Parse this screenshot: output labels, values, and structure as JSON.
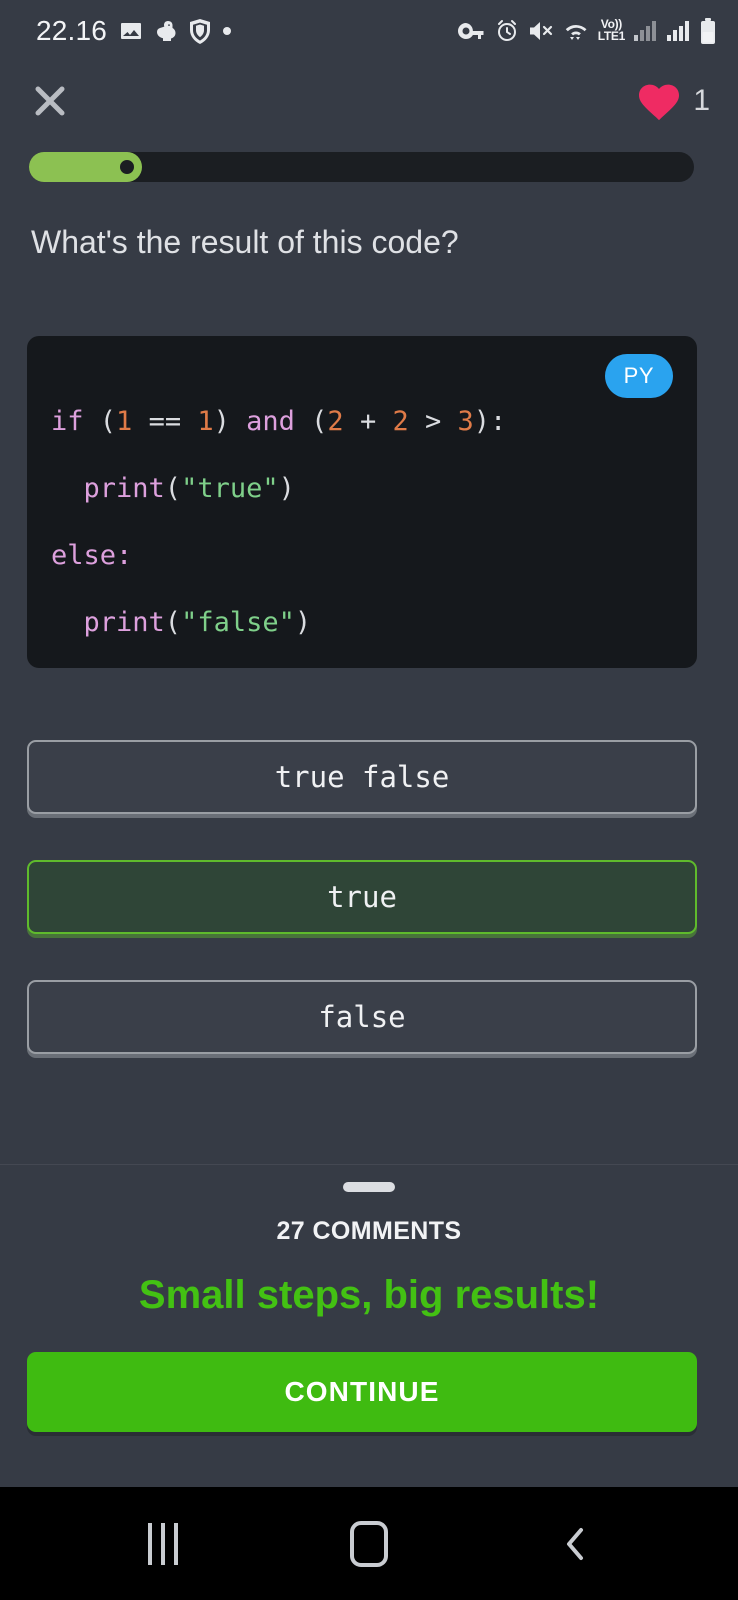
{
  "status_bar": {
    "time": "22.16",
    "left_icons": [
      "image-icon",
      "duck-icon",
      "shield-icon",
      "dot-icon"
    ],
    "right_icons": [
      "key-icon",
      "alarm-icon",
      "mute-icon",
      "wifi-icon",
      "signal-icon",
      "signal-icon",
      "battery-icon"
    ],
    "network_line1": "Vo))",
    "network_line2": "LTE1"
  },
  "header": {
    "close_label": "close-icon",
    "lives_count": "1",
    "heart_color": "#ef2b63"
  },
  "progress": {
    "percent": 17,
    "fill_color": "#8cc152",
    "track_color": "#1b1e22"
  },
  "question": {
    "text": "What's the result of this code?"
  },
  "code": {
    "language_badge": "PY",
    "badge_color": "#2aa3ef",
    "background": "#15181c",
    "lines": [
      {
        "tokens": [
          {
            "t": "if ",
            "c": "kw"
          },
          {
            "t": "(",
            "c": "pn"
          },
          {
            "t": "1",
            "c": "num"
          },
          {
            "t": " == ",
            "c": "pn"
          },
          {
            "t": "1",
            "c": "num"
          },
          {
            "t": ") ",
            "c": "pn"
          },
          {
            "t": "and",
            "c": "kw"
          },
          {
            "t": " (",
            "c": "pn"
          },
          {
            "t": "2",
            "c": "num"
          },
          {
            "t": " + ",
            "c": "pn"
          },
          {
            "t": "2",
            "c": "num"
          },
          {
            "t": " > ",
            "c": "pn"
          },
          {
            "t": "3",
            "c": "num"
          },
          {
            "t": "):",
            "c": "pn"
          }
        ]
      },
      {
        "tokens": [
          {
            "t": "  ",
            "c": "pn"
          },
          {
            "t": "print",
            "c": "fn"
          },
          {
            "t": "(",
            "c": "pn"
          },
          {
            "t": "\"true\"",
            "c": "str"
          },
          {
            "t": ")",
            "c": "pn"
          }
        ]
      },
      {
        "tokens": [
          {
            "t": "else:",
            "c": "kw"
          }
        ]
      },
      {
        "tokens": [
          {
            "t": "  ",
            "c": "pn"
          },
          {
            "t": "print",
            "c": "fn"
          },
          {
            "t": "(",
            "c": "pn"
          },
          {
            "t": "\"false\"",
            "c": "str"
          },
          {
            "t": ")",
            "c": "pn"
          }
        ]
      }
    ]
  },
  "answers": {
    "options": [
      {
        "label": "true false",
        "selected": false
      },
      {
        "label": "true",
        "selected": true
      },
      {
        "label": "false",
        "selected": false
      }
    ],
    "selected_border_color": "#5fbb2c",
    "selected_fill_color": "#2f4537",
    "default_border_color": "#9a9ea4"
  },
  "bottom_sheet": {
    "comments_label": "27 COMMENTS",
    "tagline": "Small steps, big results!",
    "tagline_color": "#43c113",
    "continue_label": "CONTINUE",
    "continue_color": "#3fbb11"
  },
  "nav_bar": {
    "recents_label": "recents-icon",
    "home_label": "home-icon",
    "back_label": "back-icon"
  }
}
